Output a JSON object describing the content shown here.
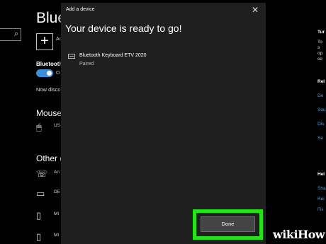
{
  "settings": {
    "title": "Blueto",
    "search_icon": "⌕",
    "add_label": "Ad",
    "bluetooth_label": "Bluetooth",
    "toggle_text": "O",
    "now_disco": "Now disco",
    "mouse_heading": "Mouse,",
    "mouse_device": "US",
    "other_heading": "Other d",
    "other_rows": [
      {
        "icon": "☏",
        "text": "An"
      },
      {
        "icon": "▭",
        "text": "DE"
      },
      {
        "icon": "▯",
        "text": "MI"
      },
      {
        "icon": "▯",
        "text": "MI"
      }
    ],
    "right_rows": [
      {
        "text": "Tur",
        "style": "bold"
      },
      {
        "text": "To",
        "style": ""
      },
      {
        "text": "s",
        "style": ""
      },
      {
        "text": "op",
        "style": ""
      },
      {
        "text": "ce",
        "style": ""
      },
      {
        "text": "Rel",
        "style": "bold"
      },
      {
        "text": "De",
        "style": "link"
      },
      {
        "text": "Sou",
        "style": "link"
      },
      {
        "text": "Dis",
        "style": "link"
      },
      {
        "text": "Se",
        "style": "link"
      },
      {
        "text": "Hel",
        "style": "bold"
      },
      {
        "text": "Sha",
        "style": "link"
      },
      {
        "text": "Rei",
        "style": "link"
      },
      {
        "text": "Fix",
        "style": "link"
      }
    ]
  },
  "dialog": {
    "title": "Add a device",
    "close": "✕",
    "heading": "Your device is ready to go!",
    "device_name": "Bluetooth Keyboard ETV 2020",
    "device_status": "Paired",
    "done_label": "Done"
  },
  "watermark": {
    "part1": "wiki",
    "part2": "How"
  },
  "colors": {
    "accent": "#3a8fd8",
    "highlight": "#22e516",
    "dialog_bg": "#1f1f1f"
  }
}
